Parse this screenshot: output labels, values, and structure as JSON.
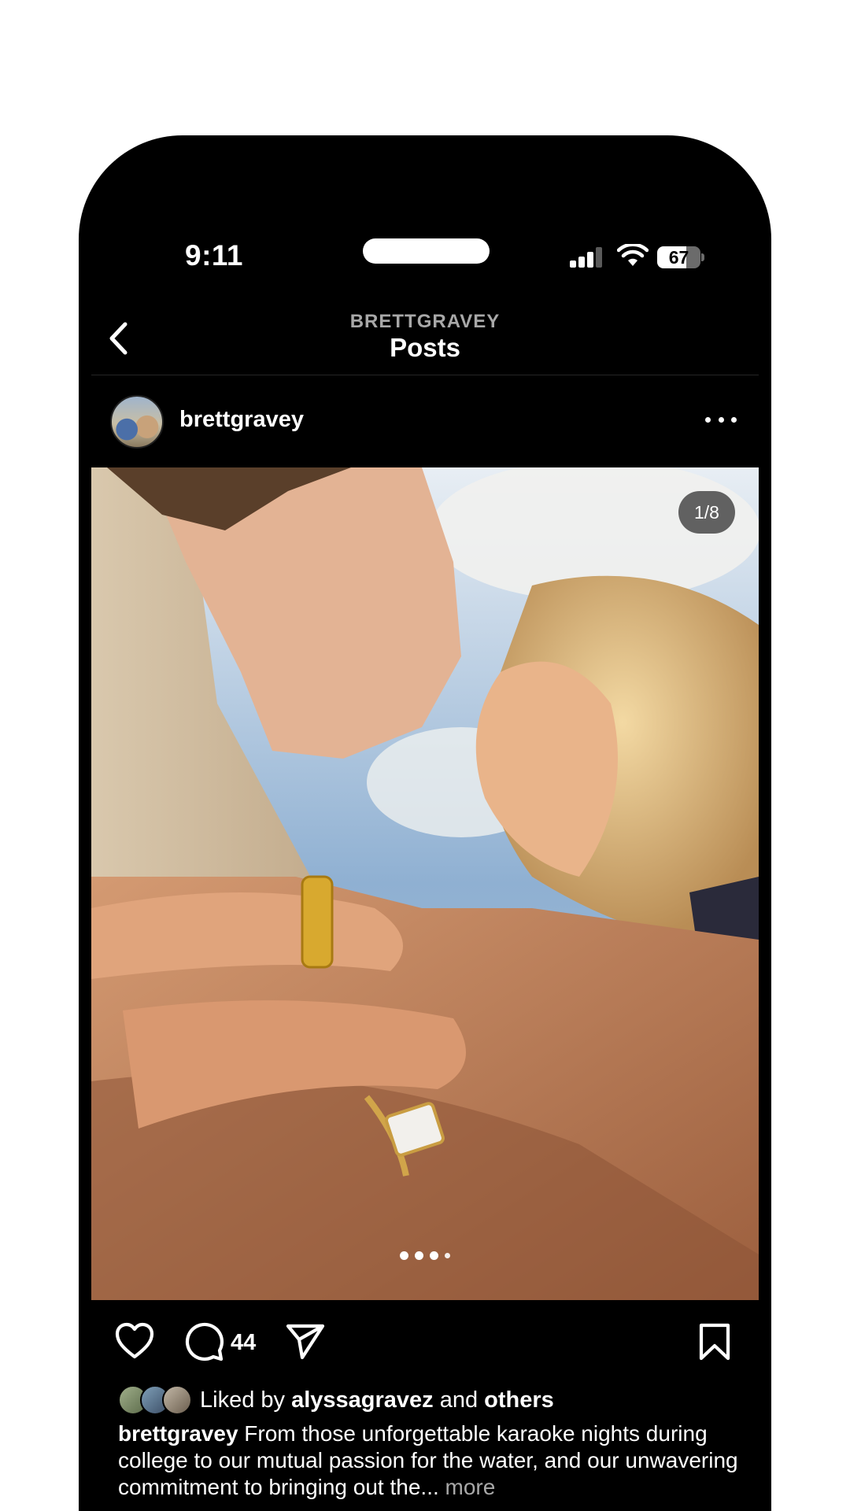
{
  "status_bar": {
    "time": "9:11",
    "battery": "67",
    "icons": [
      "signal-icon",
      "wifi-icon",
      "battery-icon"
    ]
  },
  "header": {
    "subtitle": "BRETTGRAVEY",
    "title": "Posts",
    "back_icon": "chevron-left-icon"
  },
  "post": {
    "username": "brettgravey",
    "counter": "1/8",
    "carousel": {
      "current": 1,
      "total": 8,
      "visible_dots": 4
    },
    "comment_count": "44",
    "likes": {
      "prefix": "Liked by ",
      "user": "alyssagravez",
      "middle": " and ",
      "suffix": "others"
    },
    "caption": {
      "author": "brettgravey",
      "text": " From those unforgettable karaoke nights during college to our mutual passion for the water, and our unwavering commitment to bringing out the... ",
      "more_label": "more"
    }
  },
  "colors": {
    "background": "#000000",
    "text": "#ffffff",
    "muted": "#a8a8a8",
    "divider": "#262626",
    "pill": "#323232"
  }
}
